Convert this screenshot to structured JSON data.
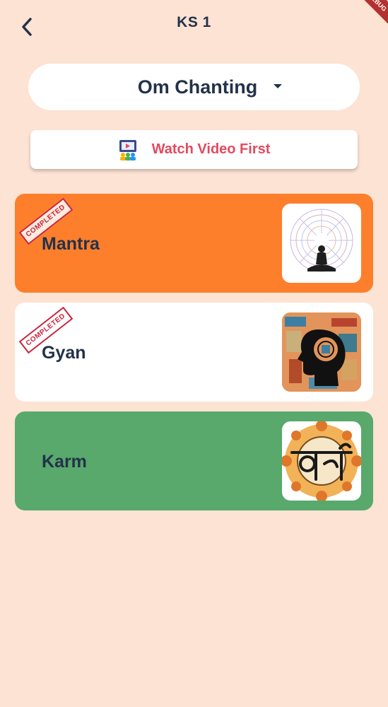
{
  "header": {
    "title": "KS 1",
    "debug_banner": "DEBUG"
  },
  "dropdown": {
    "selected": "Om Chanting"
  },
  "video_button": {
    "label": "Watch Video First"
  },
  "cards": [
    {
      "title": "Mantra",
      "status": "COMPLETED",
      "color": "#fd7f2c",
      "image": "meditation-mandala"
    },
    {
      "title": "Gyan",
      "status": "COMPLETED",
      "color": "#ffffff",
      "image": "head-silhouette-collage"
    },
    {
      "title": "Karm",
      "status": "",
      "color": "#58a96b",
      "image": "karm-mandala"
    }
  ],
  "colors": {
    "background": "#fde3d3",
    "text": "#23324a",
    "video_label": "#e34a5f",
    "stamp": "#c8243d"
  }
}
